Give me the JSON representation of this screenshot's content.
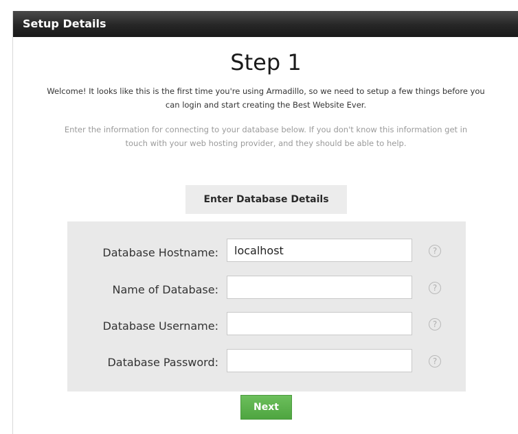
{
  "panel": {
    "title": "Setup Details"
  },
  "step": {
    "title": "Step 1",
    "welcome": "Welcome! It looks like this is the first time you're using Armadillo, so we need to setup a few things before you can login and start creating the Best Website Ever.",
    "info": "Enter the information for connecting to your database below. If you don't know this information get in touch with your web hosting provider, and they should be able to help.",
    "section_label": "Enter Database Details"
  },
  "form": {
    "fields": [
      {
        "label": "Database Hostname:",
        "value": "localhost",
        "help_icon": "help-icon"
      },
      {
        "label": "Name of Database:",
        "value": "",
        "help_icon": "help-icon"
      },
      {
        "label": "Database Username:",
        "value": "",
        "help_icon": "help-icon"
      },
      {
        "label": "Database Password:",
        "value": "",
        "help_icon": "help-icon"
      }
    ],
    "help_glyph": "?"
  },
  "actions": {
    "next_label": "Next"
  },
  "colors": {
    "header_bg": "#222222",
    "next_button": "#56ab47",
    "form_bg": "#e9e9e9"
  }
}
